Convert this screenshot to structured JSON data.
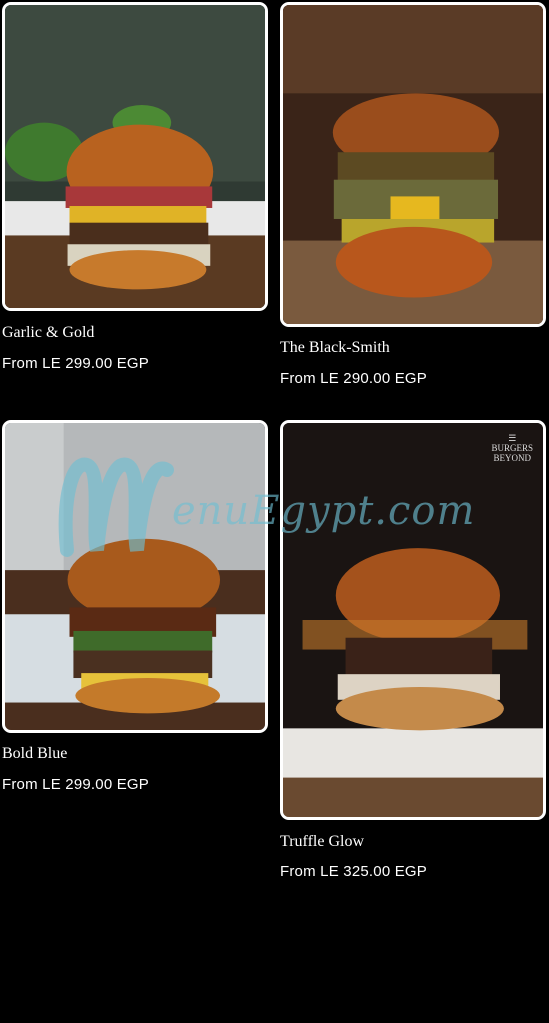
{
  "products": [
    {
      "name": "Garlic & Gold",
      "price": "From LE 299.00 EGP"
    },
    {
      "name": "The Black-Smith",
      "price": "From LE 290.00 EGP"
    },
    {
      "name": "Bold Blue",
      "price": "From LE 299.00 EGP"
    },
    {
      "name": "Truffle Glow",
      "price": "From LE 325.00 EGP"
    }
  ],
  "watermark": {
    "text": "enuEgypt.com"
  },
  "brand_badge": {
    "line1": "BURGERS",
    "line2": "BEYOND"
  }
}
